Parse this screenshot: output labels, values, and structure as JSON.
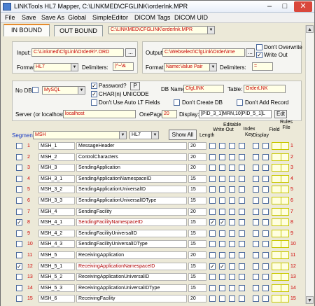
{
  "window": {
    "title": "LINKTools HL7 Mapper, C:\\LINKMED\\CFGLINK\\orderlnk.MPR",
    "minimize_glyph": "–",
    "maximize_glyph": "□",
    "close_glyph": "✕"
  },
  "menu": [
    "File",
    "Save",
    "Save As",
    "Global",
    "SimpleEditor",
    "DICOM Tags",
    "DICOM UID"
  ],
  "tabs": [
    "IN BOUND",
    "OUT BOUND"
  ],
  "mpr_path": "C:\\LINKMED\\CFGLINK\\orderlnk.MPR",
  "input": {
    "label": "Input:",
    "value": "C:\\Linkmed\\CfgLink\\OrderR\\*.ORD",
    "browse": "...",
    "format_label": "Format:",
    "format_value": "HL7",
    "delimiters_label": "Delimiters:",
    "delimiters_value": "|^~\\&"
  },
  "output": {
    "label": "Output:",
    "value": "C:\\Webselect\\CfgLink\\Order\\Ime",
    "browse": "...",
    "dont_overwrite": "Don't Overwrite",
    "write_out": "Write Out",
    "format_label": "Format:",
    "format_value": "Name:Value Pair",
    "delimiters_label": "Delimiters:",
    "delimiters_value": "="
  },
  "db": {
    "no_db_label": "No DB",
    "engine": "MySQL",
    "password_label": "Password?",
    "password_btn": "P",
    "char_unicode": "CHAR(n) UNICODE",
    "no_auto_lt": "Don't Use Auto LT Fields",
    "db_name_label": "DB Name:",
    "db_name_value": "CfgLINK",
    "table_label": "Table:",
    "table_value": "OrderLNK",
    "dont_create_db": "Don't Create DB",
    "dont_add_record": "Don't Add Record",
    "server_label": "Server (or localhost):",
    "server_value": "localhost",
    "onepage_label": "OnePage:",
    "onepage_value": "20",
    "display_label": "Display:",
    "display_value": "[PID_3_1]MRN,10[PID_5_1]L",
    "edit_btn": "Edt"
  },
  "segment": {
    "label": "Segment",
    "value": "MSH",
    "type_value": "HL7",
    "show_all": "Show All"
  },
  "headers": {
    "length": "Length",
    "write_out": "Write Out",
    "editable": "Editable",
    "index_key": "Index\nKey",
    "display": "Display",
    "field": "Field",
    "rules_file": "Rules\nFile"
  },
  "rows": [
    {
      "num": "1",
      "id": "MSH_1",
      "name": "MessageHeader",
      "length": "20",
      "checked": false,
      "highlight": false,
      "right_num": "1"
    },
    {
      "num": "2",
      "id": "MSH_2",
      "name": "ControlCharacters",
      "length": "20",
      "checked": false,
      "highlight": false,
      "right_num": "2"
    },
    {
      "num": "3",
      "id": "MSH_3",
      "name": "SendingApplication",
      "length": "20",
      "checked": false,
      "highlight": false,
      "right_num": "3"
    },
    {
      "num": "4",
      "id": "MSH_3_1",
      "name": "SendingApplicationNamespaceID",
      "length": "15",
      "checked": false,
      "highlight": false,
      "right_num": "4"
    },
    {
      "num": "5",
      "id": "MSH_3_2",
      "name": "SendingApplicationUniversalID",
      "length": "15",
      "checked": false,
      "highlight": false,
      "right_num": "5"
    },
    {
      "num": "6",
      "id": "MSH_3_3",
      "name": "SendingApplicationUniversalIDType",
      "length": "15",
      "checked": false,
      "highlight": false,
      "right_num": "6"
    },
    {
      "num": "7",
      "id": "MSH_4",
      "name": "SendingFacility",
      "length": "20",
      "checked": false,
      "highlight": false,
      "right_num": "7"
    },
    {
      "num": "8",
      "id": "MSH_4_1",
      "name": "SendingFacilityNamespaceID",
      "length": "15",
      "checked": true,
      "highlight": true,
      "right_num": "8"
    },
    {
      "num": "9",
      "id": "MSH_4_2",
      "name": "SendingFacilityUniversalID",
      "length": "15",
      "checked": false,
      "highlight": false,
      "right_num": "9"
    },
    {
      "num": "10",
      "id": "MSH_4_3",
      "name": "SendingFacilityUniversalIDType",
      "length": "15",
      "checked": false,
      "highlight": false,
      "right_num": "10"
    },
    {
      "num": "11",
      "id": "MSH_5",
      "name": "ReceivingApplication",
      "length": "20",
      "checked": false,
      "highlight": false,
      "right_num": "11"
    },
    {
      "num": "12",
      "id": "MSH_5_1",
      "name": "ReceivingApplicationNamespaceID",
      "length": "15",
      "checked": true,
      "highlight": true,
      "right_num": "12"
    },
    {
      "num": "13",
      "id": "MSH_5_2",
      "name": "ReceivingApplicationUniversalID",
      "length": "15",
      "checked": false,
      "highlight": false,
      "right_num": "13"
    },
    {
      "num": "14",
      "id": "MSH_5_3",
      "name": "ReceivingApplicationUniversalIDType",
      "length": "15",
      "checked": false,
      "highlight": false,
      "right_num": "14"
    },
    {
      "num": "15",
      "id": "MSH_6",
      "name": "ReceivingFacility",
      "length": "20",
      "checked": false,
      "highlight": false,
      "right_num": "15"
    }
  ],
  "scroll": {
    "up": "▲",
    "down": "▼"
  },
  "colors": {
    "accent_red": "#d00000",
    "field_bg": "#ffffe6",
    "highlight": "#fff4c0"
  }
}
